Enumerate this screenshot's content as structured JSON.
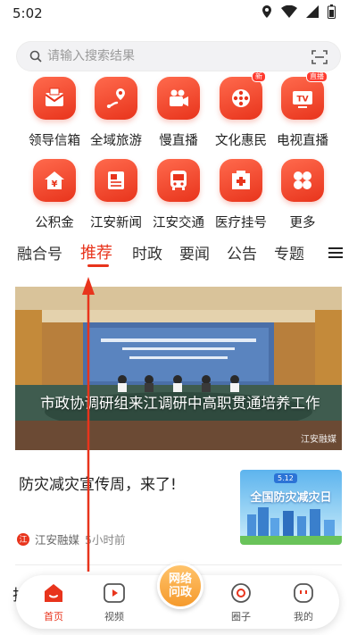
{
  "status": {
    "time": "5:02"
  },
  "search": {
    "placeholder": "请输入搜索结果"
  },
  "grid": {
    "row1": [
      {
        "label": "领导信箱",
        "icon": "mailbox-icon"
      },
      {
        "label": "全域旅游",
        "icon": "location-route-icon"
      },
      {
        "label": "慢直播",
        "icon": "video-camera-icon"
      },
      {
        "label": "文化惠民",
        "icon": "film-reel-icon",
        "badge": "新"
      },
      {
        "label": "电视直播",
        "icon": "tv-icon",
        "badge": "直播"
      }
    ],
    "row2": [
      {
        "label": "公积金",
        "icon": "house-fund-icon"
      },
      {
        "label": "江安新闻",
        "icon": "news-icon"
      },
      {
        "label": "江安交通",
        "icon": "bus-icon"
      },
      {
        "label": "医疗挂号",
        "icon": "hospital-icon"
      },
      {
        "label": "更多",
        "icon": "more-grid-icon"
      }
    ]
  },
  "tabs": [
    "融合号",
    "推荐",
    "时政",
    "要闻",
    "公告",
    "专题"
  ],
  "active_tab": "推荐",
  "hero": {
    "caption": "市政协调研组来江调研中高职贯通培养工作",
    "watermark": "江安融媒"
  },
  "article": {
    "title": "防灾减灾宣传周，来了!",
    "source": "江安融媒",
    "time": "5小时前",
    "thumb_tag": "5.12",
    "thumb_title": "全国防灾减灾日"
  },
  "peek": {
    "text": "护"
  },
  "bottom_nav": {
    "home": "首页",
    "video": "视频",
    "center_line1": "网络",
    "center_line2": "问政",
    "circle": "圈子",
    "mine": "我的"
  },
  "colors": {
    "accent": "#e8341c",
    "center": "#f59a2c"
  }
}
